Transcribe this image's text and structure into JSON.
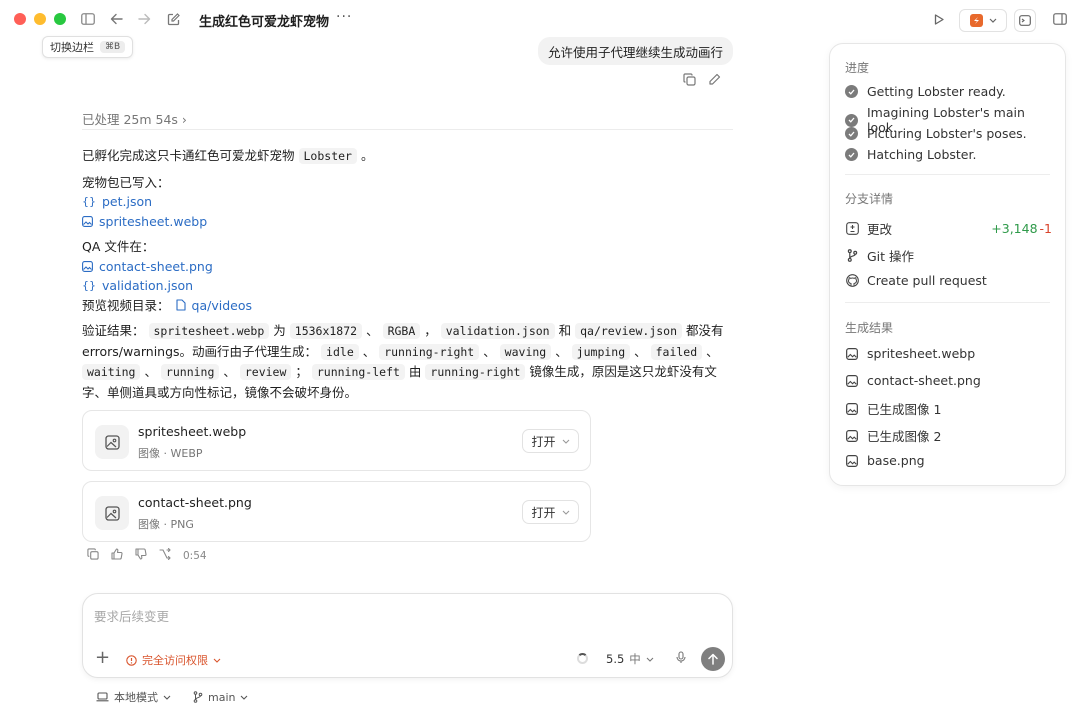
{
  "titlebar": {
    "title": "生成红色可爱龙虾宠物",
    "more": "···"
  },
  "tooltip": {
    "label": "切换边栏",
    "shortcut": "⌘B"
  },
  "user_message": "允许使用子代理继续生成动画行",
  "processed": "已处理 25m 54s ›",
  "assistant": {
    "intro_prefix": "已孵化完成这只卡通红色可爱龙虾宠物",
    "intro_code": "Lobster",
    "intro_suffix": "。",
    "pack_label": "宠物包已写入：",
    "pack_files": [
      "pet.json",
      "spritesheet.webp"
    ],
    "qa_label": "QA 文件在：",
    "qa_files": [
      "contact-sheet.png",
      "validation.json"
    ],
    "video_label": "预览视频目录：",
    "video_dir": "qa/videos",
    "verify_prefix": "验证结果：",
    "verify_code1": "spritesheet.webp",
    "verify_is": "为",
    "verify_code2": "1536x1872",
    "verify_sep1": "、",
    "verify_code3": "RGBA",
    "verify_sep2": "，",
    "verify_code4": "validation.json",
    "verify_and": "和",
    "verify_code5": "qa/review.json",
    "verify_none": "都没有",
    "verify_line2": "errors/warnings。动画行由子代理生成：",
    "anim_rows": [
      "idle",
      "running-right",
      "waving",
      "jumping",
      "failed",
      "waiting",
      "running",
      "review"
    ],
    "mirror_code1": "running-left",
    "mirror_by": "由",
    "mirror_code2": "running-right",
    "mirror_text": "镜像生成，原因是这只龙虾没有文字、单侧道具或方向性标记，镜像不会破坏身份。"
  },
  "cards": [
    {
      "name": "spritesheet.webp",
      "meta": "图像 · WEBP",
      "open": "打开"
    },
    {
      "name": "contact-sheet.png",
      "meta": "图像 · PNG",
      "open": "打开"
    }
  ],
  "msg_duration": "0:54",
  "composer": {
    "placeholder": "要求后续变更",
    "access": "完全访问权限",
    "model": "5.5",
    "effort": "中"
  },
  "footer": {
    "mode": "本地模式",
    "branch": "main"
  },
  "panel": {
    "progress_title": "进度",
    "progress": [
      "Getting Lobster ready.",
      "Imagining Lobster's main look.",
      "Picturing Lobster's poses.",
      "Hatching Lobster."
    ],
    "branch_title": "分支详情",
    "changes_label": "更改",
    "changes_plus": "+3,148",
    "changes_minus": "-1",
    "git_label": "Git 操作",
    "pr_label": "Create pull request",
    "results_title": "生成结果",
    "results": [
      "spritesheet.webp",
      "contact-sheet.png",
      "已生成图像 1",
      "已生成图像 2",
      "base.png"
    ]
  }
}
